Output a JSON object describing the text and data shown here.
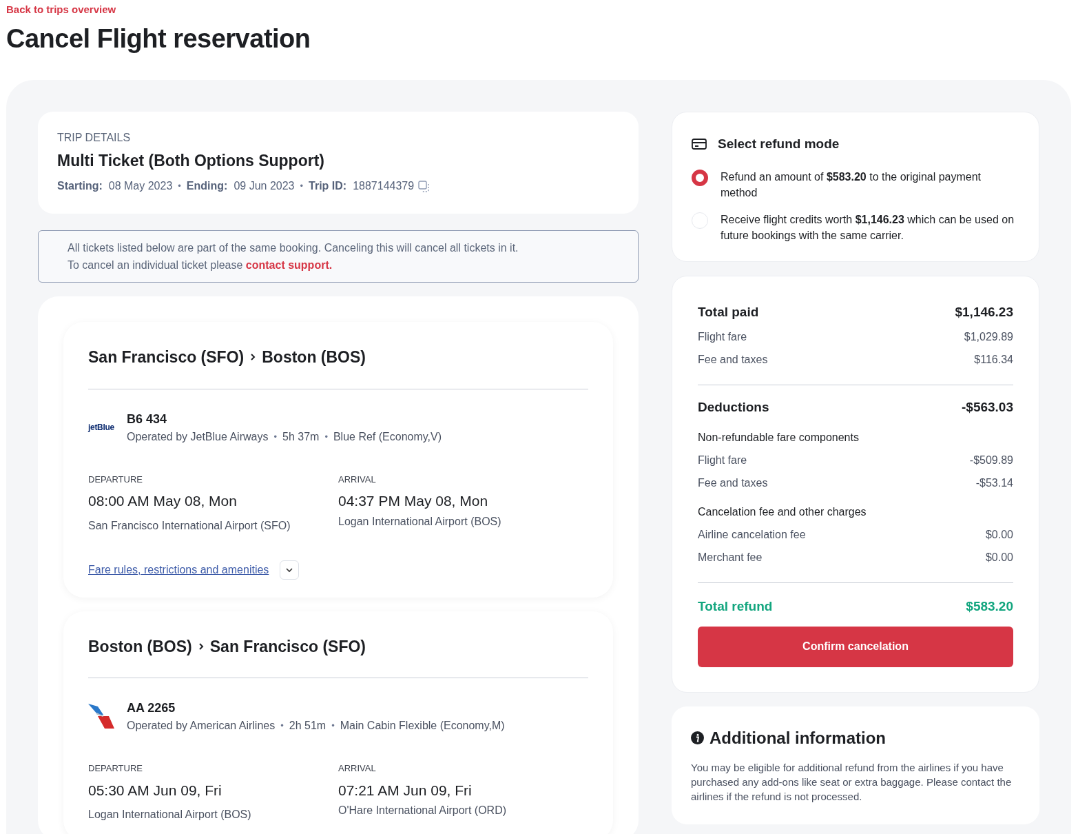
{
  "back_link": "Back to trips overview",
  "title": "Cancel Flight reservation",
  "trip": {
    "eyebrow": "TRIP DETAILS",
    "name": "Multi Ticket (Both Options Support)",
    "separator": "•",
    "meta": [
      {
        "label": "Starting:",
        "value": "08 May 2023"
      },
      {
        "label": "Ending:",
        "value": "09 Jun 2023"
      },
      {
        "label": "Trip ID:",
        "value": "1887144379"
      }
    ]
  },
  "notice": {
    "line1": "All tickets listed below are part of the same booking. Canceling this will cancel all tickets in it.",
    "line2": "To cancel an individual ticket please",
    "link": "contact support."
  },
  "segments": [
    {
      "from": "San Francisco (SFO)",
      "to": "Boston (BOS)",
      "logo": {
        "kind": "wordmark",
        "text": "jetBlue"
      },
      "flight": "B6 434",
      "details": [
        "Operated by JetBlue Airways",
        "5h 37m",
        "Blue Ref (Economy,V)"
      ],
      "separator": "•",
      "departure": {
        "label": "DEPARTURE",
        "time": "08:00 AM May 08, Mon",
        "airport": "San Francisco International Airport (SFO)"
      },
      "arrival": {
        "label": "ARRIVAL",
        "time": "04:37 PM May 08, Mon",
        "airport": "Logan International Airport (BOS)"
      },
      "fare_link": "Fare rules, restrictions and amenities",
      "expanded": false
    },
    {
      "from": "Boston (BOS)",
      "to": "San Francisco (SFO)",
      "logo": {
        "kind": "tail"
      },
      "flight": "AA 2265",
      "details": [
        "Operated by American Airlines",
        "2h 51m",
        "Main Cabin Flexible (Economy,M)"
      ],
      "separator": "•",
      "departure": {
        "label": "DEPARTURE",
        "time": "05:30 AM Jun 09, Fri",
        "airport": "Logan International Airport (BOS)"
      },
      "arrival": {
        "label": "ARRIVAL",
        "time": "07:21 AM Jun 09, Fri",
        "airport": "O'Hare International Airport (ORD)"
      }
    }
  ],
  "refund_mode": {
    "title": "Select refund mode",
    "options": [
      {
        "text": "Refund an amount of **$583.20** to the original payment method",
        "selected": true
      },
      {
        "text": "Receive flight credits worth **$1,146.23** which can be used on future bookings with the same carrier.",
        "selected": false
      }
    ]
  },
  "summary": {
    "sections": [
      {
        "heading": "Total paid",
        "amount": "$1,146.23",
        "groups": [
          {
            "lines": [
              {
                "label": "Flight fare",
                "amount": "$1,029.89"
              },
              {
                "label": "Fee and taxes",
                "amount": "$116.34"
              }
            ]
          }
        ]
      },
      {
        "heading": "Deductions",
        "amount": "-$563.03",
        "groups": [
          {
            "title": "Non-refundable fare components",
            "lines": [
              {
                "label": "Flight fare",
                "amount": "-$509.89"
              },
              {
                "label": "Fee and taxes",
                "amount": "-$53.14"
              }
            ]
          },
          {
            "title": "Cancelation fee and other charges",
            "lines": [
              {
                "label": "Airline cancelation fee",
                "amount": "$0.00"
              },
              {
                "label": "Merchant fee",
                "amount": "$0.00"
              }
            ]
          }
        ]
      }
    ],
    "total": {
      "label": "Total refund",
      "amount": "$583.20"
    },
    "button": "Confirm cancelation"
  },
  "additional": {
    "title": "Additional information",
    "text": "You may be eligible for additional refund from the airlines if you have purchased any add-ons like seat or extra baggage. Please contact the airlines if the refund is not processed."
  }
}
